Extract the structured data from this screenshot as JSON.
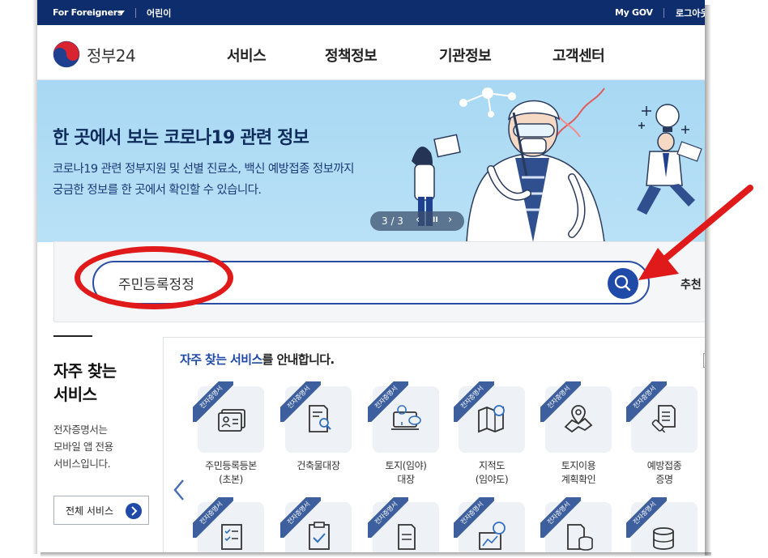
{
  "topbar": {
    "foreigners": "For Foreigners",
    "kids": "어린이",
    "mygov": "My GOV",
    "login": "로그아웃"
  },
  "header": {
    "logo_text": "정부24",
    "nav": [
      "서비스",
      "정책정보",
      "기관정보",
      "고객센터"
    ]
  },
  "banner": {
    "title": "한 곳에서 보는 코로나19 관련 정보",
    "desc1": "코로나19 관련 정부지원 및 선별 진료소, 백신 예방접종 정보까지",
    "desc2": "궁금한 정보를 한 곳에서 확인할 수 있습니다.",
    "pager": "3 / 3",
    "prev": "‹",
    "pause": "II",
    "next": "›"
  },
  "search": {
    "value": "주민등록정정",
    "reco": "추천"
  },
  "sidebar": {
    "title1": "자주 찾는",
    "title2": "서비스",
    "desc1": "전자증명서는",
    "desc2": "모바일 앱 전용",
    "desc3": "서비스입니다.",
    "all_button": "전체 서비스"
  },
  "services": {
    "head_highlight": "자주 찾는 서비스",
    "head_rest": "를 안내합니다.",
    "ribbon": "전자증명서",
    "row1": [
      {
        "l1": "주민등록등본",
        "l2": "(초본)"
      },
      {
        "l1": "건축물대장",
        "l2": ""
      },
      {
        "l1": "토지(임야)",
        "l2": "대장"
      },
      {
        "l1": "지적도",
        "l2": "(임야도)"
      },
      {
        "l1": "토지이용",
        "l2": "계획확인"
      },
      {
        "l1": "예방접종",
        "l2": "증명"
      }
    ]
  },
  "colors": {
    "navy": "#0d2d6c",
    "accent": "#1f4aa8",
    "banner": "#b9e1f6",
    "annotation": "#e01a1a"
  }
}
